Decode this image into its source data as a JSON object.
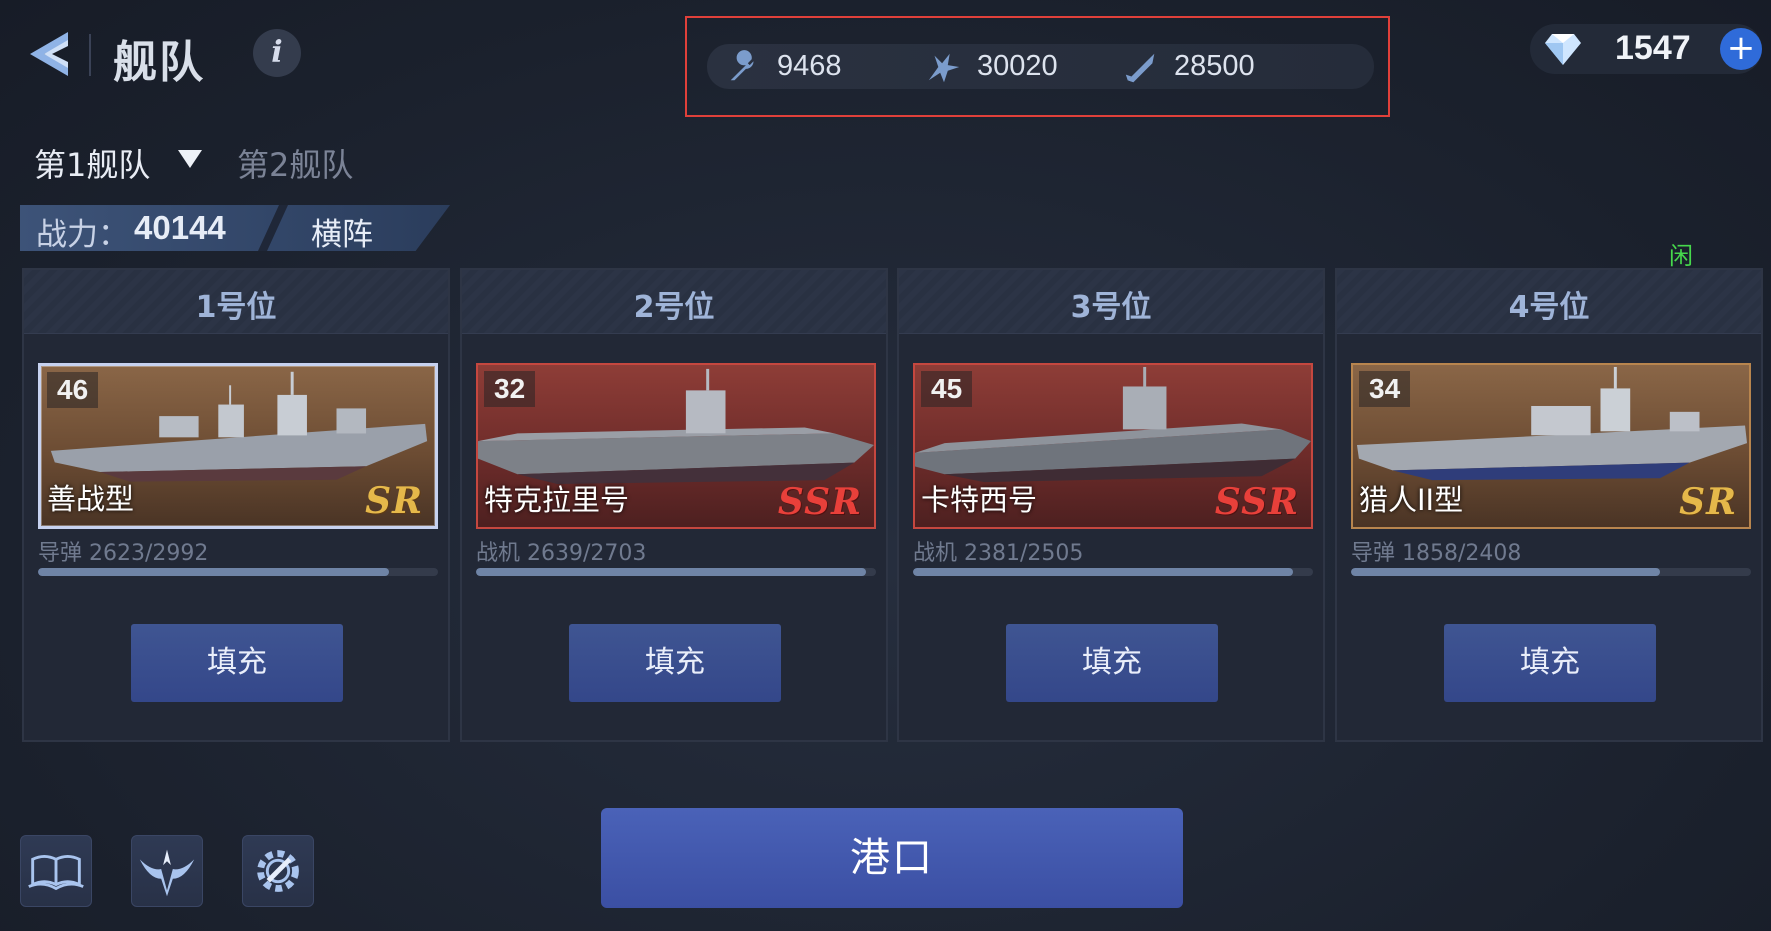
{
  "header": {
    "title": "舰队",
    "back_icon": "back-arrow-icon",
    "info_icon": "info-icon",
    "info_glyph": "i"
  },
  "resources": [
    {
      "icon": "wrench-icon",
      "value": "9468"
    },
    {
      "icon": "aircraft-icon",
      "value": "30020"
    },
    {
      "icon": "missile-icon",
      "value": "28500"
    }
  ],
  "gems": {
    "icon": "diamond-icon",
    "value": "1547",
    "plus": "+"
  },
  "fleet_tabs": {
    "active": "第1舰队",
    "inactive": "第2舰队"
  },
  "power": {
    "label": "战力：",
    "value": "40144",
    "formation": "横阵"
  },
  "idle_badge": "闲",
  "slots": [
    {
      "title": "1号位",
      "level": "46",
      "ship_name": "善战型",
      "rarity": "SR",
      "ammo_label": "导弹 2623/2992",
      "ammo_fraction": 0.877,
      "fill_label": "填充"
    },
    {
      "title": "2号位",
      "level": "32",
      "ship_name": "特克拉里号",
      "rarity": "SSR",
      "ammo_label": "战机 2639/2703",
      "ammo_fraction": 0.976,
      "fill_label": "填充"
    },
    {
      "title": "3号位",
      "level": "45",
      "ship_name": "卡特西号",
      "rarity": "SSR",
      "ammo_label": "战机 2381/2505",
      "ammo_fraction": 0.951,
      "fill_label": "填充"
    },
    {
      "title": "4号位",
      "level": "34",
      "ship_name": "猎人II型",
      "rarity": "SR",
      "ammo_label": "导弹 1858/2408",
      "ammo_fraction": 0.772,
      "fill_label": "填充"
    }
  ],
  "bottom": {
    "port_label": "港口",
    "icons": [
      "book-icon",
      "wing-emblem-icon",
      "gear-wrench-icon"
    ]
  },
  "colors": {
    "accent": "#3b4fa3",
    "sr": "#e5b84a",
    "ssr": "#e8403a",
    "highlight": "#e0403a"
  }
}
